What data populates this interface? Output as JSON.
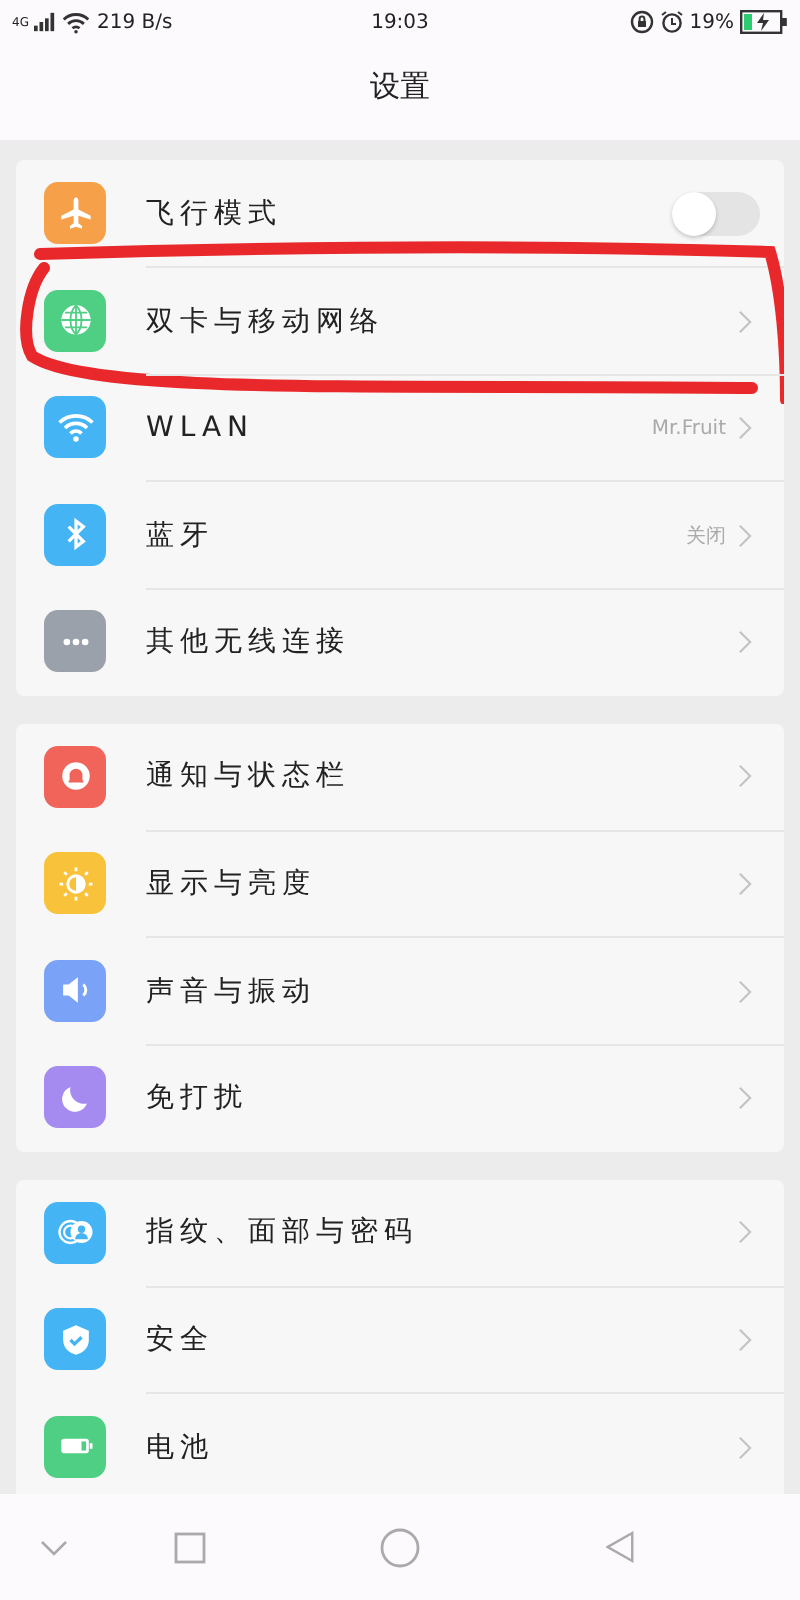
{
  "status_bar": {
    "network": "4G",
    "speed": "219 B/s",
    "time": "19:03",
    "battery": "19%"
  },
  "title": "设置",
  "groups": [
    {
      "items": [
        {
          "kind": "toggle",
          "label": "飞行模式",
          "color": "#f6a04a",
          "on": false
        },
        {
          "kind": "link",
          "label": "双卡与移动网络",
          "color": "#4fcf84",
          "circled": true
        },
        {
          "kind": "link",
          "label": "WLAN",
          "color": "#45b4f5",
          "value": "Mr.Fruit"
        },
        {
          "kind": "link",
          "label": "蓝牙",
          "color": "#45b4f5",
          "value": "关闭"
        },
        {
          "kind": "link",
          "label": "其他无线连接",
          "color": "#9aa1ab"
        }
      ]
    },
    {
      "items": [
        {
          "kind": "link",
          "label": "通知与状态栏",
          "color": "#f0645a"
        },
        {
          "kind": "link",
          "label": "显示与亮度",
          "color": "#f8c23a"
        },
        {
          "kind": "link",
          "label": "声音与振动",
          "color": "#7aa3f7"
        },
        {
          "kind": "link",
          "label": "免打扰",
          "color": "#a58af0"
        }
      ]
    },
    {
      "items": [
        {
          "kind": "link",
          "label": "指纹、面部与密码",
          "color": "#45b4f5"
        },
        {
          "kind": "link",
          "label": "安全",
          "color": "#45b4f5"
        },
        {
          "kind": "link",
          "label": "电池",
          "color": "#4fcf84"
        }
      ]
    }
  ]
}
